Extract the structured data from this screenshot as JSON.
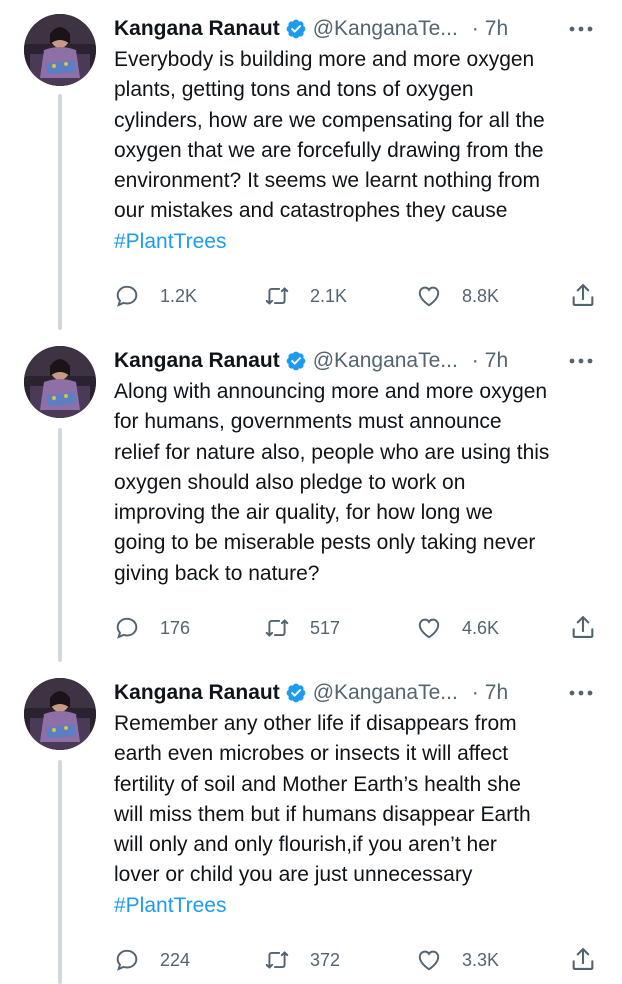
{
  "colors": {
    "text": "#0f1419",
    "secondary": "#536471",
    "link": "#1d9bf0",
    "verified": "#1d9bf0",
    "thread_line": "#cfd9de"
  },
  "tweets": [
    {
      "name": "Kangana Ranaut",
      "handle": "@KanganaTe...",
      "separator": "·",
      "time": "7h",
      "text": "Everybody is building more and more oxygen\nplants, getting tons and tons of oxygen\ncylinders, how are we compensating for all the\noxygen that we are forcefully drawing from the\nenvironment? It seems we learnt nothing from\nour mistakes and catastrophes they cause",
      "hashtag": "#PlantTrees",
      "replies": "1.2K",
      "retweets": "2.1K",
      "likes": "8.8K",
      "icons": {
        "reply": "reply-icon",
        "retweet": "retweet-icon",
        "like": "heart-icon",
        "share": "share-icon",
        "more": "more-icon",
        "verified": "verified-badge-icon"
      }
    },
    {
      "name": "Kangana Ranaut",
      "handle": "@KanganaTe...",
      "separator": "·",
      "time": "7h",
      "text": "Along with announcing more and more oxygen\nfor humans, governments must announce\nrelief for nature also, people who are using this\noxygen should also pledge to work on\nimproving the air quality, for how long we\ngoing to be miserable pests only taking never\ngiving back to nature?",
      "hashtag": "",
      "replies": "176",
      "retweets": "517",
      "likes": "4.6K",
      "icons": {
        "reply": "reply-icon",
        "retweet": "retweet-icon",
        "like": "heart-icon",
        "share": "share-icon",
        "more": "more-icon",
        "verified": "verified-badge-icon"
      }
    },
    {
      "name": "Kangana Ranaut",
      "handle": "@KanganaTe...",
      "separator": "·",
      "time": "7h",
      "text": "Remember any other life if disappears from\nearth even microbes or insects it will affect\nfertility of soil and Mother Earth’s health she\nwill miss them but if humans disappear Earth\nwill only and only flourish,if you aren’t her\nlover or child you are just unnecessary",
      "hashtag": "#PlantTrees",
      "replies": "224",
      "retweets": "372",
      "likes": "3.3K",
      "icons": {
        "reply": "reply-icon",
        "retweet": "retweet-icon",
        "like": "heart-icon",
        "share": "share-icon",
        "more": "more-icon",
        "verified": "verified-badge-icon"
      }
    }
  ]
}
